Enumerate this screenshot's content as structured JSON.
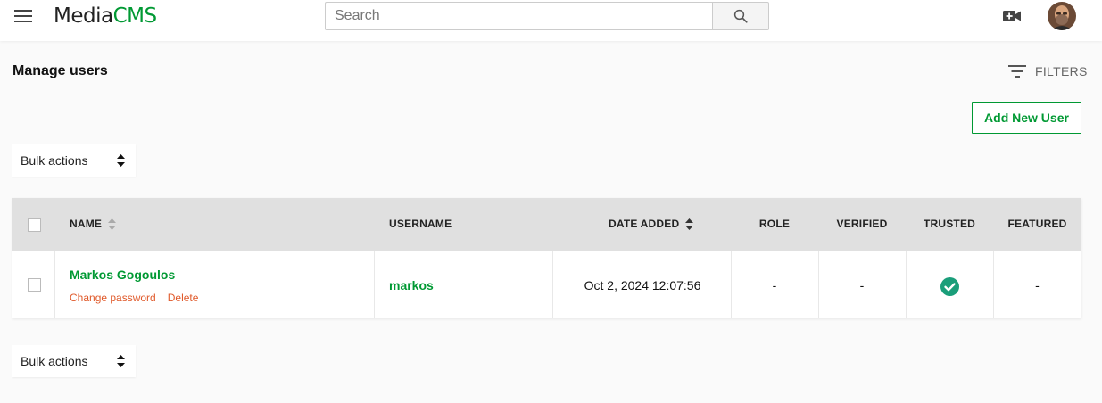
{
  "header": {
    "logo_part1": "Media",
    "logo_part2": "CMS",
    "search_placeholder": "Search"
  },
  "page": {
    "title": "Manage users",
    "filters_label": "FILTERS",
    "add_user_label": "Add New User",
    "bulk_actions_label": "Bulk actions"
  },
  "table": {
    "columns": {
      "name": "NAME",
      "username": "USERNAME",
      "date_added": "DATE ADDED",
      "role": "ROLE",
      "verified": "VERIFIED",
      "trusted": "TRUSTED",
      "featured": "FEATURED"
    },
    "rows": [
      {
        "name": "Markos Gogoulos",
        "change_password": "Change password",
        "delete": "Delete",
        "username": "markos",
        "date_added": "Oct 2, 2024 12:07:56",
        "role": "-",
        "verified": "-",
        "trusted": true,
        "featured": "-"
      }
    ]
  },
  "colors": {
    "accent": "#009933",
    "danger_link": "#e05a2b",
    "trusted_check": "#1a9e7a",
    "header_bg": "#e0e0e0"
  },
  "icons": [
    "hamburger-icon",
    "search-icon",
    "video-upload-icon",
    "filter-icon",
    "sort-arrows-icon",
    "check-circle-icon",
    "select-arrows-icon"
  ]
}
